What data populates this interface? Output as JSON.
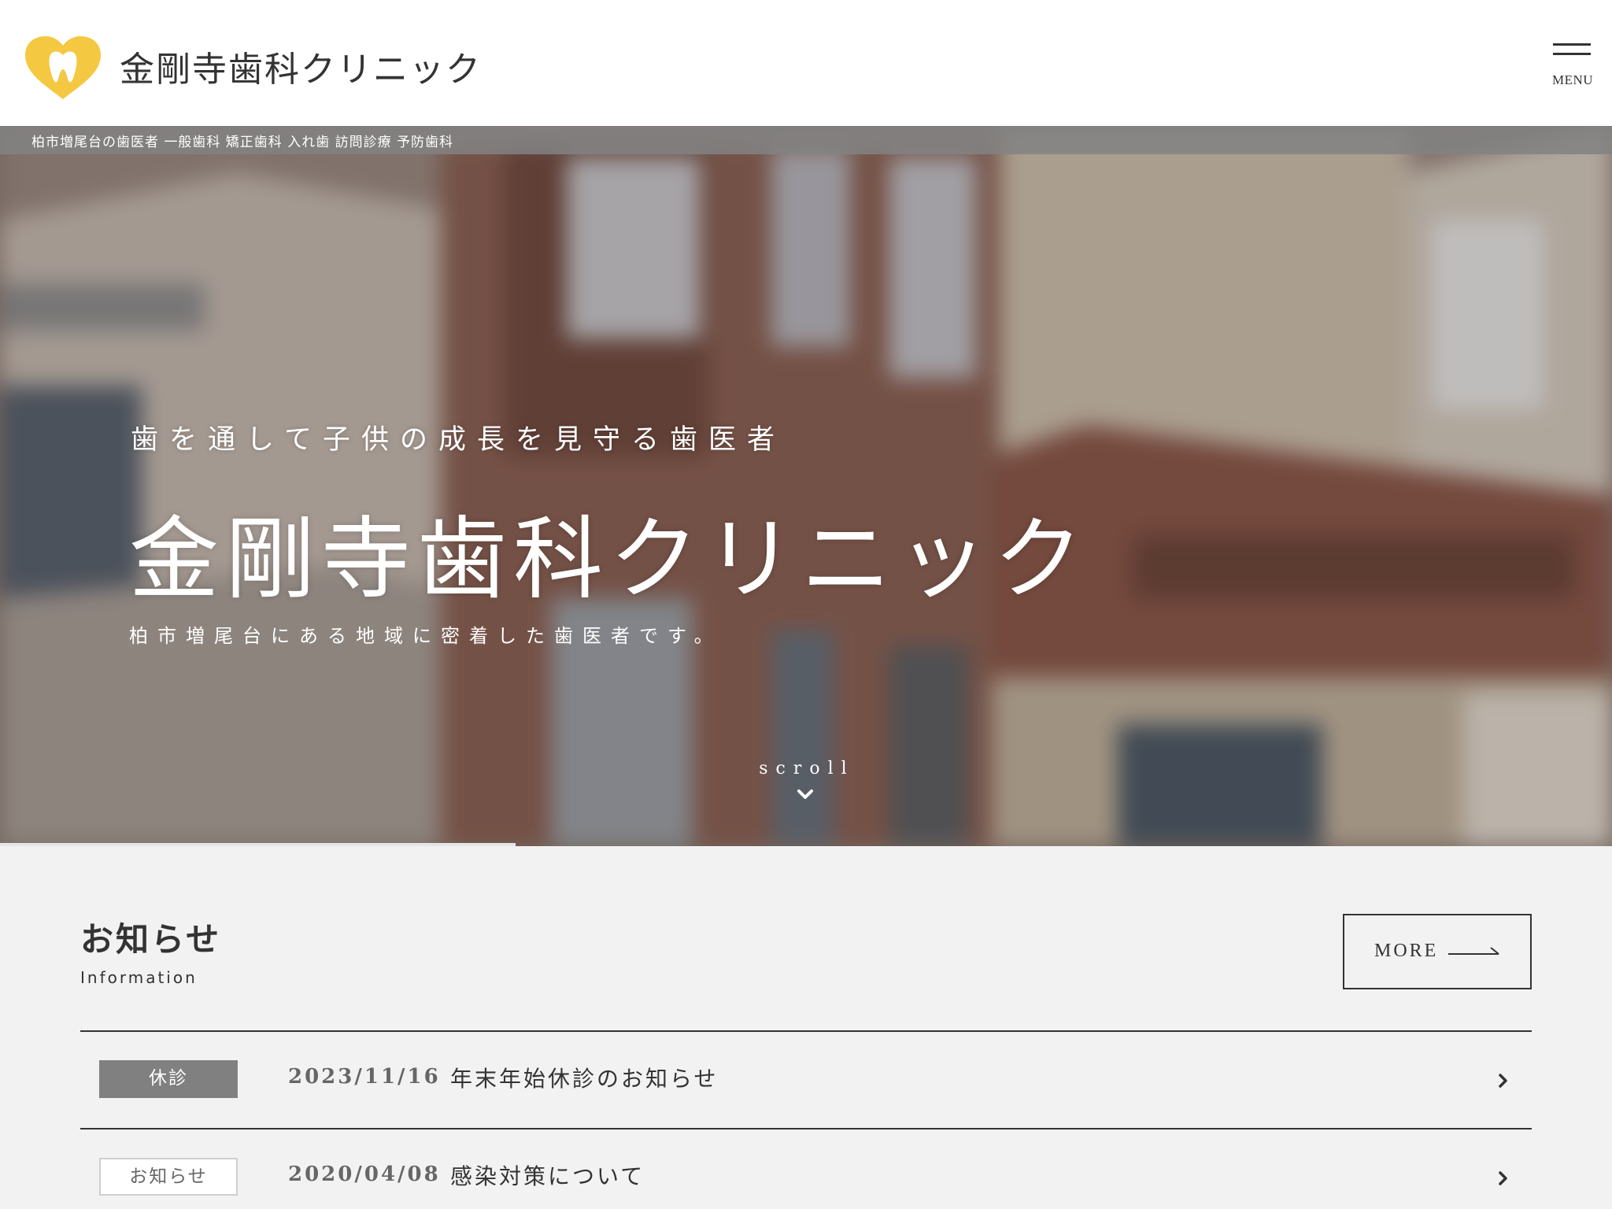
{
  "colors": {
    "accent_yellow": "#f5c842",
    "text_dark": "#333333",
    "badge_gray": "#808080",
    "section_bg": "#f2f2f2"
  },
  "header": {
    "logo_text": "金剛寺歯科クリニック",
    "logo_icon": "tooth-heart-icon",
    "menu_label": "MENU",
    "menu_icon": "hamburger-icon"
  },
  "hero": {
    "tagline": "柏市増尾台の歯医者 一般歯科 矯正歯科 入れ歯 訪問診療 予防歯科",
    "subtitle": "歯を通して子供の成長を見守る歯医者",
    "title": "金剛寺歯科クリニック",
    "description": "柏市増尾台にある地域に密着した歯医者です。",
    "scroll_label": "scroll",
    "scroll_icon": "chevron-down-icon",
    "slide_progress": 0.32
  },
  "info": {
    "title": "お知らせ",
    "subtitle": "Information",
    "more_label": "MORE",
    "more_icon": "arrow-right-icon",
    "items": [
      {
        "category": "休診",
        "date": "2023/11/16",
        "text": "年末年始休診のお知らせ"
      },
      {
        "category": "お知らせ",
        "date": "2020/04/08",
        "text": "感染対策について"
      }
    ]
  }
}
